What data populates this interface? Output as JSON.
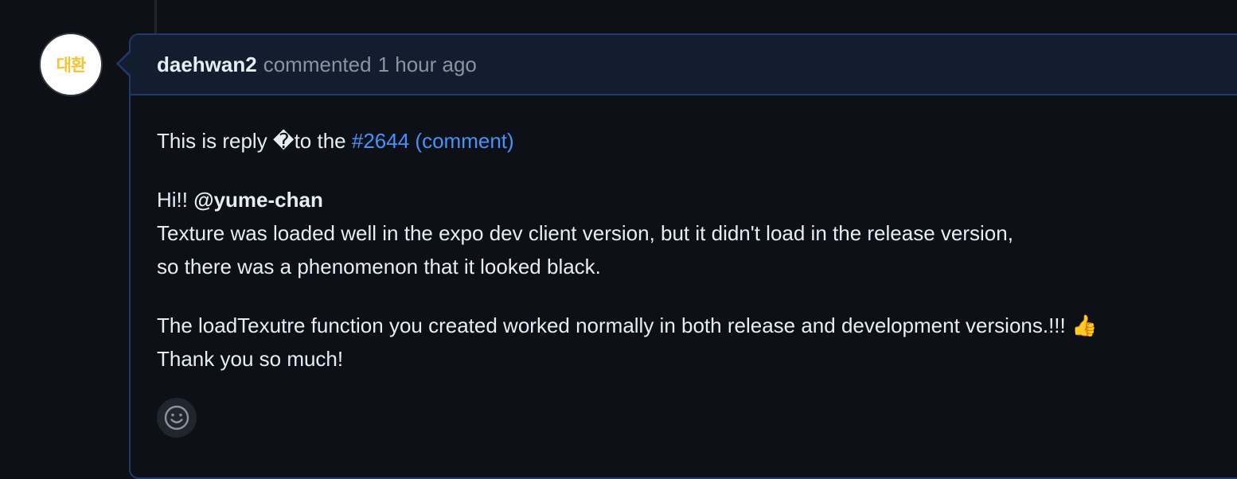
{
  "comment": {
    "avatar_text": "대환",
    "author": "daehwan2",
    "action": "commented",
    "timestamp": "1 hour ago",
    "reply_prefix": "This is reply �to the",
    "reply_link_issue": "#2644",
    "reply_link_comment": "(comment)",
    "greeting": "Hi!!",
    "mention": "@yume-chan",
    "line1": "Texture was loaded well in the expo dev client version, but it didn't load in the release version,",
    "line2": "so there was a phenomenon that it looked black.",
    "line3": "The loadTexutre function you created worked normally in both release and development versions.!!! 👍",
    "line4": "Thank you so much!"
  },
  "icons": {
    "reaction": "smiley-icon"
  },
  "colors": {
    "link": "#4493f8",
    "border_accent": "#1f3a6b",
    "avatar_text": "#f7c22f"
  }
}
